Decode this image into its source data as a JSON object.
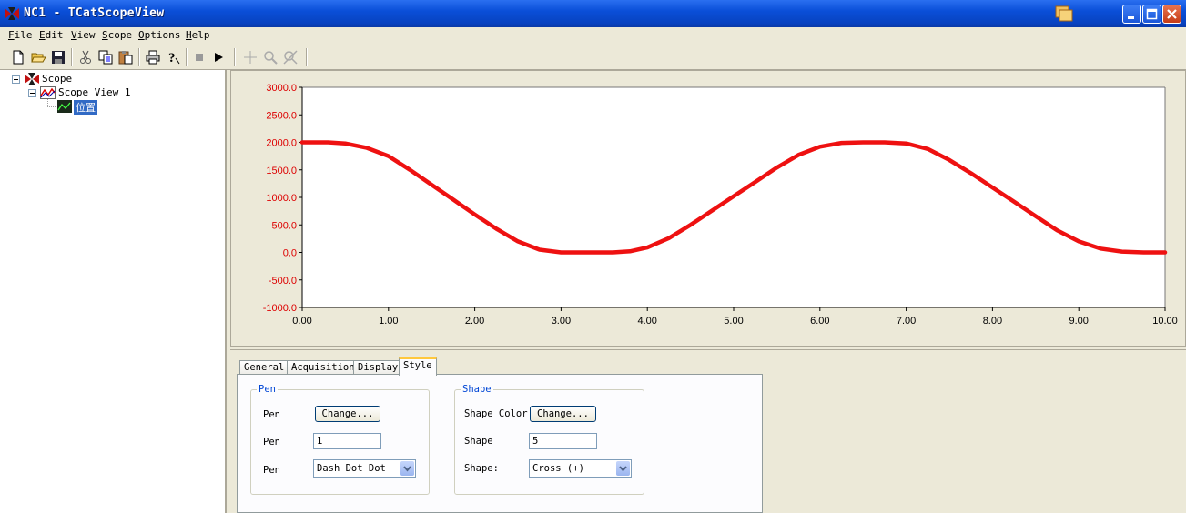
{
  "window": {
    "title": "NC1 - TCatScopeView"
  },
  "menu": [
    {
      "label": "File",
      "key": "F",
      "rest": "ile"
    },
    {
      "label": "Edit",
      "key": "E",
      "rest": "dit"
    },
    {
      "label": "View",
      "key": "V",
      "rest": "iew"
    },
    {
      "label": "Scope",
      "key": "S",
      "rest": "cope"
    },
    {
      "label": "Options",
      "key": "O",
      "rest": "ptions"
    },
    {
      "label": "Help",
      "key": "H",
      "rest": "elp"
    }
  ],
  "toolbar": {
    "icons": [
      "new-icon",
      "open-icon",
      "save-icon",
      "cut-icon",
      "copy-icon",
      "paste-icon",
      "print-icon",
      "help-icon",
      "stop-icon",
      "play-icon",
      "crosshair-icon",
      "zoom-icon",
      "zoom-off-icon"
    ]
  },
  "tree": {
    "root": "Scope",
    "view": "Scope View 1",
    "channel": "位置"
  },
  "chart_data": {
    "type": "line",
    "title": "",
    "xlabel": "",
    "ylabel": "",
    "xlim": [
      0,
      10
    ],
    "ylim": [
      -1000,
      3000
    ],
    "xticks": [
      "0.00",
      "1.00",
      "2.00",
      "3.00",
      "4.00",
      "5.00",
      "6.00",
      "7.00",
      "8.00",
      "9.00",
      "10.00"
    ],
    "yticks": [
      "3000.0",
      "2500.0",
      "2000.0",
      "1500.0",
      "1000.0",
      "500.0",
      "0.0",
      "-500.0",
      "-1000.0"
    ],
    "grid": false,
    "colors": {
      "line": "#ee1111",
      "ticks": "#dd0000"
    },
    "series": [
      {
        "x": [
          0,
          0.3,
          0.5,
          0.75,
          1.0,
          1.25,
          1.5,
          1.75,
          2.0,
          2.25,
          2.5,
          2.75,
          3.0,
          3.2,
          3.4,
          3.6,
          3.8,
          4.0,
          4.25,
          4.5,
          4.75,
          5.0,
          5.25,
          5.5,
          5.75,
          6.0,
          6.25,
          6.5,
          6.75,
          7.0,
          7.25,
          7.5,
          7.75,
          8.0,
          8.25,
          8.5,
          8.75,
          9.0,
          9.25,
          9.5,
          9.75,
          10.0
        ],
        "y": [
          2000,
          2000,
          1980,
          1900,
          1750,
          1500,
          1230,
          960,
          690,
          430,
          200,
          50,
          0,
          0,
          0,
          0,
          20,
          90,
          260,
          500,
          760,
          1020,
          1280,
          1540,
          1770,
          1920,
          1990,
          2000,
          2000,
          1980,
          1880,
          1680,
          1440,
          1180,
          920,
          660,
          400,
          200,
          70,
          15,
          0,
          0
        ]
      }
    ]
  },
  "tabs": [
    "General",
    "Acquisition",
    "Display",
    "Style"
  ],
  "active_tab": "Style",
  "pen_group": {
    "title": "Pen",
    "color_label": "Pen",
    "color_button": "Change...",
    "width_label": "Pen",
    "width_value": "1",
    "style_label": "Pen",
    "style_value": "Dash Dot Dot"
  },
  "shape_group": {
    "title": "Shape",
    "color_label": "Shape Color:",
    "color_button": "Change...",
    "size_label": "Shape",
    "size_value": "5",
    "type_label": "Shape:",
    "type_value": "Cross (+)"
  }
}
